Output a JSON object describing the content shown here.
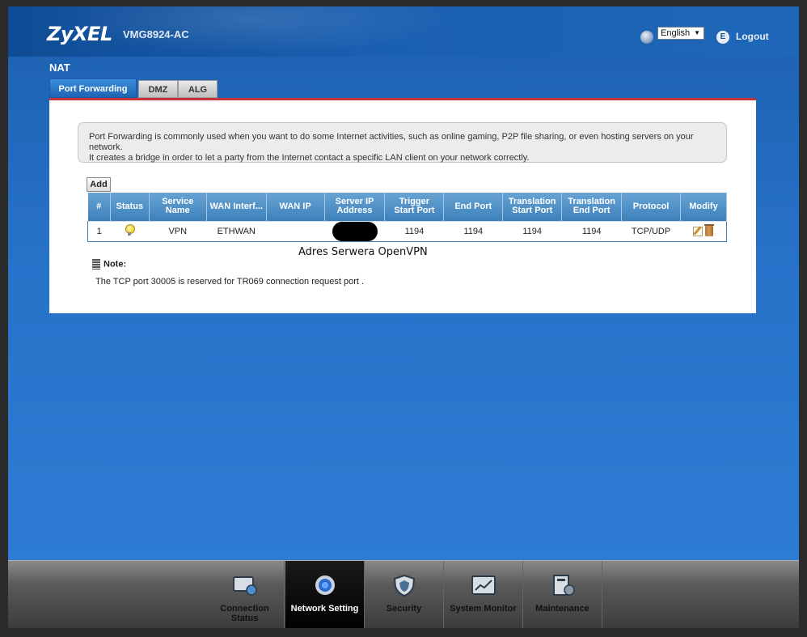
{
  "header": {
    "brand": "ZyXEL",
    "model": "VMG8924-AC",
    "language": "English",
    "logout_label": "Logout"
  },
  "page": {
    "title": "NAT",
    "tabs": [
      {
        "label": "Port Forwarding",
        "active": true
      },
      {
        "label": "DMZ",
        "active": false
      },
      {
        "label": "ALG",
        "active": false
      }
    ],
    "info_text_line1": "Port Forwarding is commonly used when you want to do some Internet activities, such as online gaming, P2P file sharing, or even hosting servers on your network.",
    "info_text_line2": "It creates a bridge in order to let a party from the Internet contact a specific LAN client on your network correctly.",
    "add_label": "Add"
  },
  "table": {
    "headers": {
      "index": "#",
      "status": "Status",
      "service_name": "Service Name",
      "wan_interface": "WAN Interf...",
      "wan_ip": "WAN IP",
      "server_ip": "Server IP Address",
      "trigger_start": "Trigger Start Port",
      "end_port": "End Port",
      "translation_start": "Translation Start Port",
      "translation_end": "Translation End Port",
      "protocol": "Protocol",
      "modify": "Modify"
    },
    "rows": [
      {
        "index": "1",
        "status": "enabled",
        "service_name": "VPN",
        "wan_interface": "ETHWAN",
        "wan_ip": "",
        "server_ip": "",
        "trigger_start": "1194",
        "end_port": "1194",
        "translation_start": "1194",
        "translation_end": "1194",
        "protocol": "TCP/UDP"
      }
    ]
  },
  "annotation": "Adres Serwera OpenVPN",
  "note": {
    "title": "Note:",
    "text": "The TCP port 30005 is reserved for TR069 connection request port ."
  },
  "bottom_nav": [
    {
      "label": "Connection Status",
      "icon": "connection-status-icon",
      "active": false
    },
    {
      "label": "Network Setting",
      "icon": "network-setting-icon",
      "active": true
    },
    {
      "label": "Security",
      "icon": "security-shield-icon",
      "active": false
    },
    {
      "label": "System Monitor",
      "icon": "system-monitor-icon",
      "active": false
    },
    {
      "label": "Maintenance",
      "icon": "maintenance-icon",
      "active": false
    }
  ],
  "colors": {
    "background_blue": "#2772c9",
    "accent_red": "#c8333a",
    "table_header_blue": "#4a8bc3"
  }
}
